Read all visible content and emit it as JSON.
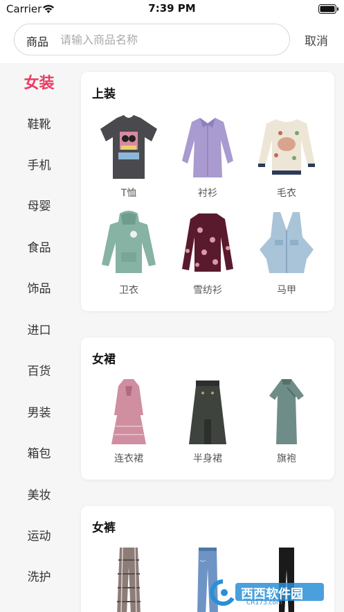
{
  "status_bar": {
    "carrier": "Carrier",
    "time": "7:39 PM"
  },
  "search": {
    "scope": "商品",
    "placeholder": "请输入商品名称",
    "cancel": "取消"
  },
  "sidebar": {
    "items": [
      {
        "label": "女装",
        "active": true
      },
      {
        "label": "鞋靴"
      },
      {
        "label": "手机"
      },
      {
        "label": "母婴"
      },
      {
        "label": "食品"
      },
      {
        "label": "饰品"
      },
      {
        "label": "进口"
      },
      {
        "label": "百货"
      },
      {
        "label": "男装"
      },
      {
        "label": "箱包"
      },
      {
        "label": "美妆"
      },
      {
        "label": "运动"
      },
      {
        "label": "洗护"
      }
    ]
  },
  "sections": [
    {
      "title": "上装",
      "items": [
        {
          "label": "T恤",
          "icon": "tshirt-icon"
        },
        {
          "label": "衬衫",
          "icon": "shirt-icon"
        },
        {
          "label": "毛衣",
          "icon": "sweater-icon"
        },
        {
          "label": "卫衣",
          "icon": "hoodie-icon"
        },
        {
          "label": "雪纺衫",
          "icon": "chiffon-blouse-icon"
        },
        {
          "label": "马甲",
          "icon": "vest-icon"
        }
      ]
    },
    {
      "title": "女裙",
      "items": [
        {
          "label": "连衣裙",
          "icon": "dress-icon"
        },
        {
          "label": "半身裙",
          "icon": "skirt-icon"
        },
        {
          "label": "旗袍",
          "icon": "qipao-icon"
        }
      ]
    },
    {
      "title": "女裤",
      "items": [
        {
          "label": "",
          "icon": "plaid-pants-icon"
        },
        {
          "label": "",
          "icon": "jeans-icon"
        },
        {
          "label": "",
          "icon": "leggings-icon"
        }
      ]
    }
  ],
  "watermark": {
    "text": "西西软件园",
    "url_text": "CR173.com"
  },
  "colors": {
    "accent": "#ec3a63",
    "sidebar_bg": "#f6f6f6"
  }
}
